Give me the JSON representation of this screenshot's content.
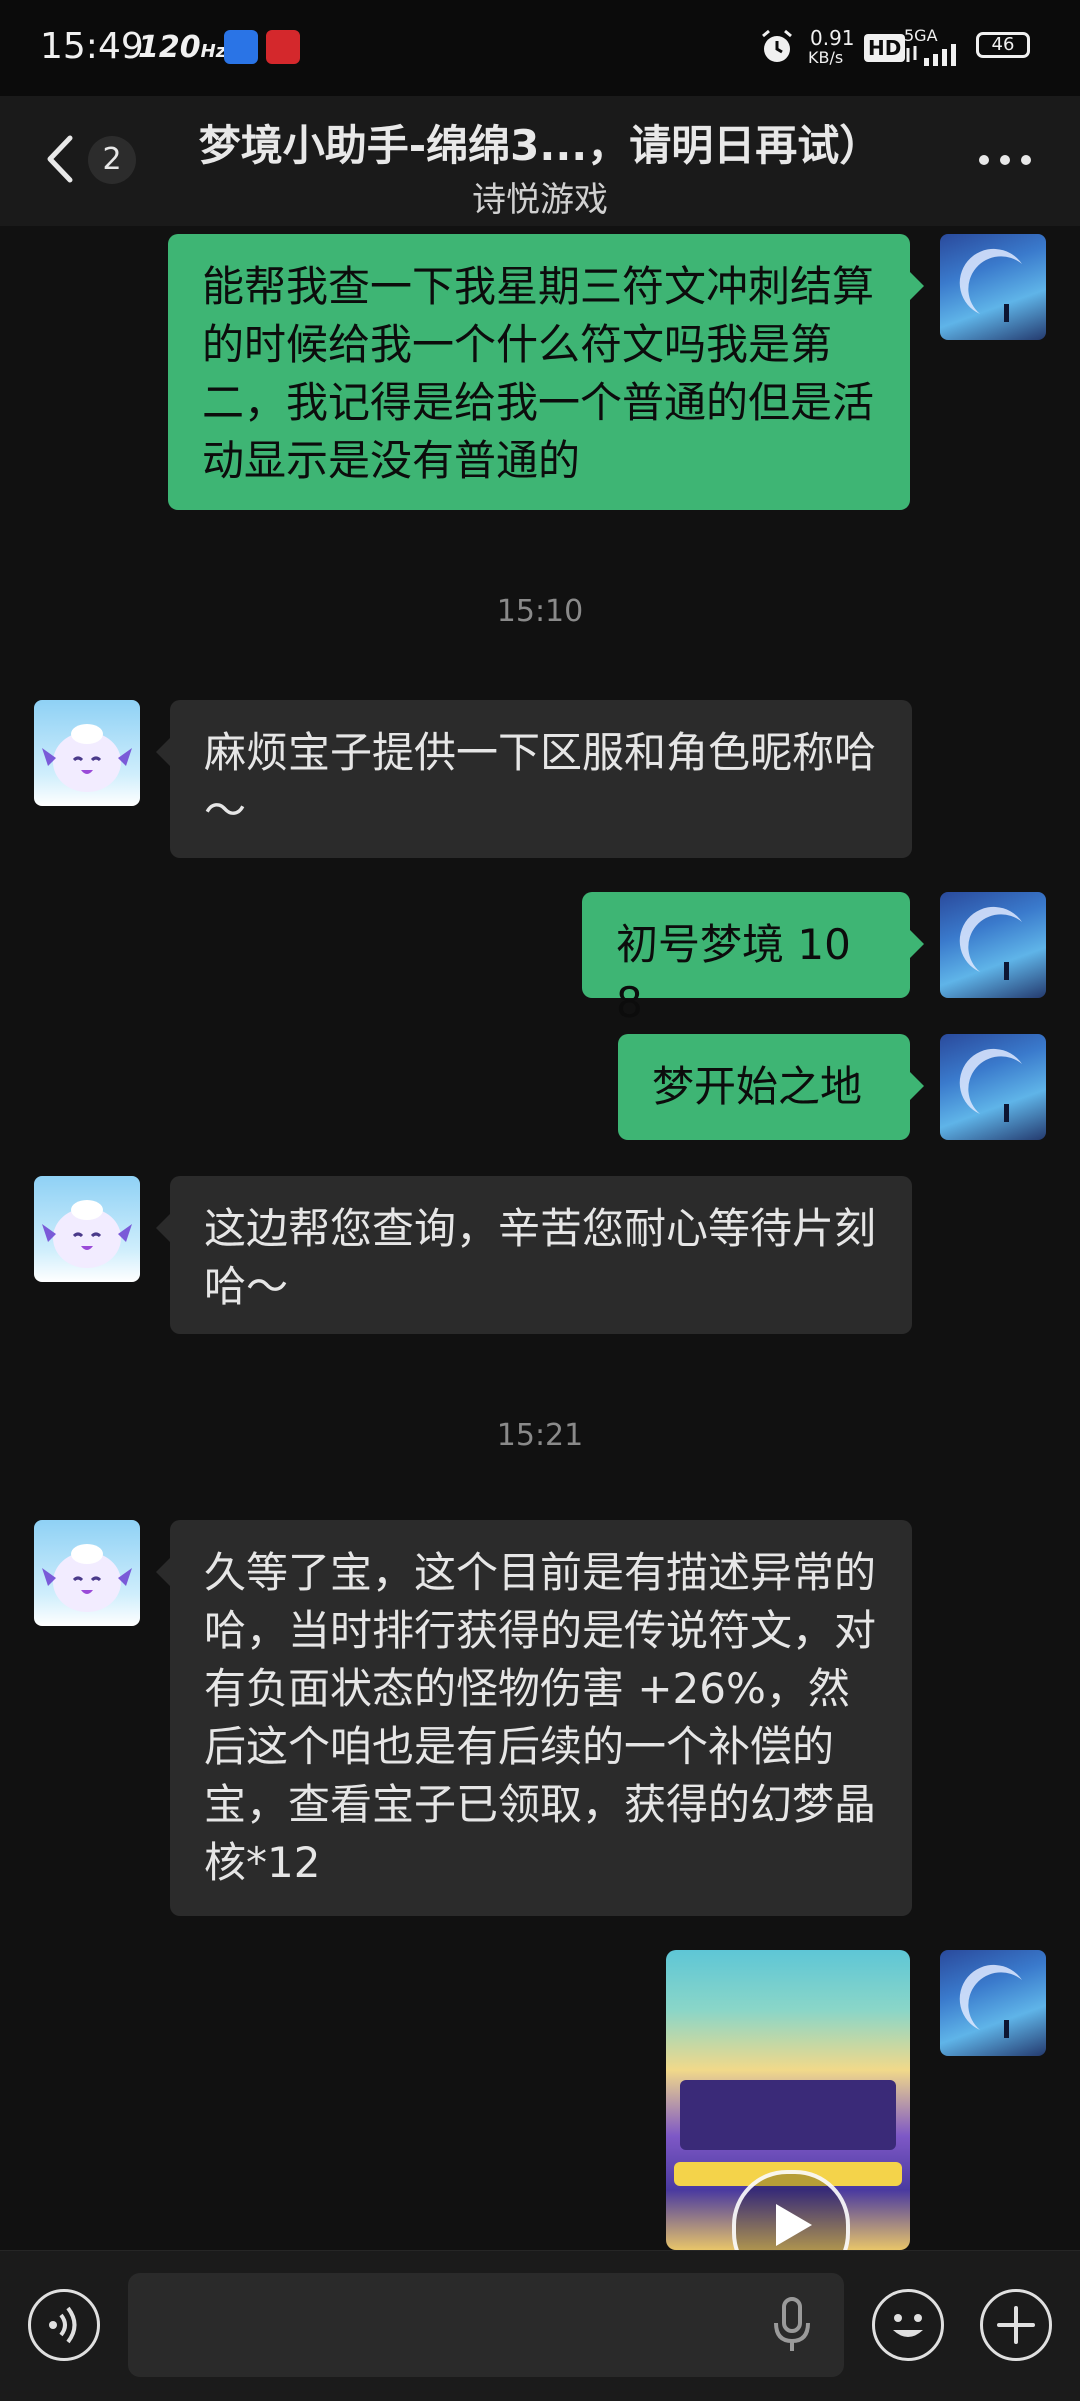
{
  "status_bar": {
    "time": "15:49",
    "refresh_rate": "120",
    "refresh_unit": "Hz",
    "app_icon_a_text": "",
    "app_icon_b_text": "",
    "speed_value": "0.91",
    "speed_unit": "KB/s",
    "hd_label": "HD",
    "network": "5GA",
    "battery": "46"
  },
  "header": {
    "unread_count": "2",
    "title": "梦境小助手-绵绵3...，请明日再试）",
    "subtitle": "诗悦游戏"
  },
  "messages": [
    {
      "side": "right",
      "text": "能帮我查一下我星期三符文冲刺结算的时候给我一个什么符文吗我是第二，我记得是给我一个普通的但是活动显示是没有普通的"
    },
    {
      "side": "left",
      "text": "麻烦宝子提供一下区服和角色昵称哈～"
    },
    {
      "side": "right",
      "text": "初号梦境 108"
    },
    {
      "side": "right",
      "text": "梦开始之地"
    },
    {
      "side": "left",
      "text": "这边帮您查询，辛苦您耐心等待片刻哈～"
    },
    {
      "side": "left",
      "text": "久等了宝，这个目前是有描述异常的哈，当时排行获得的是传说符文，对有负面状态的怪物伤害 +26%，然后这个咱也是有后续的一个补偿的宝，查看宝子已领取，获得的幻梦晶核*12"
    }
  ],
  "timestamps": [
    "15:10",
    "15:21"
  ],
  "input": {
    "value": "",
    "placeholder": ""
  },
  "colors": {
    "background": "#111111",
    "header": "#1a1a1a",
    "bubble_self": "#3eb574",
    "bubble_other": "#2b2b2b",
    "timestamp": "#8a8a8a"
  },
  "icons": {
    "back": "back-arrow-icon",
    "more": "more-dots-icon",
    "voice": "voice-icon",
    "mic": "mic-icon",
    "emoji": "emoji-icon",
    "plus": "plus-icon",
    "play": "play-icon"
  }
}
